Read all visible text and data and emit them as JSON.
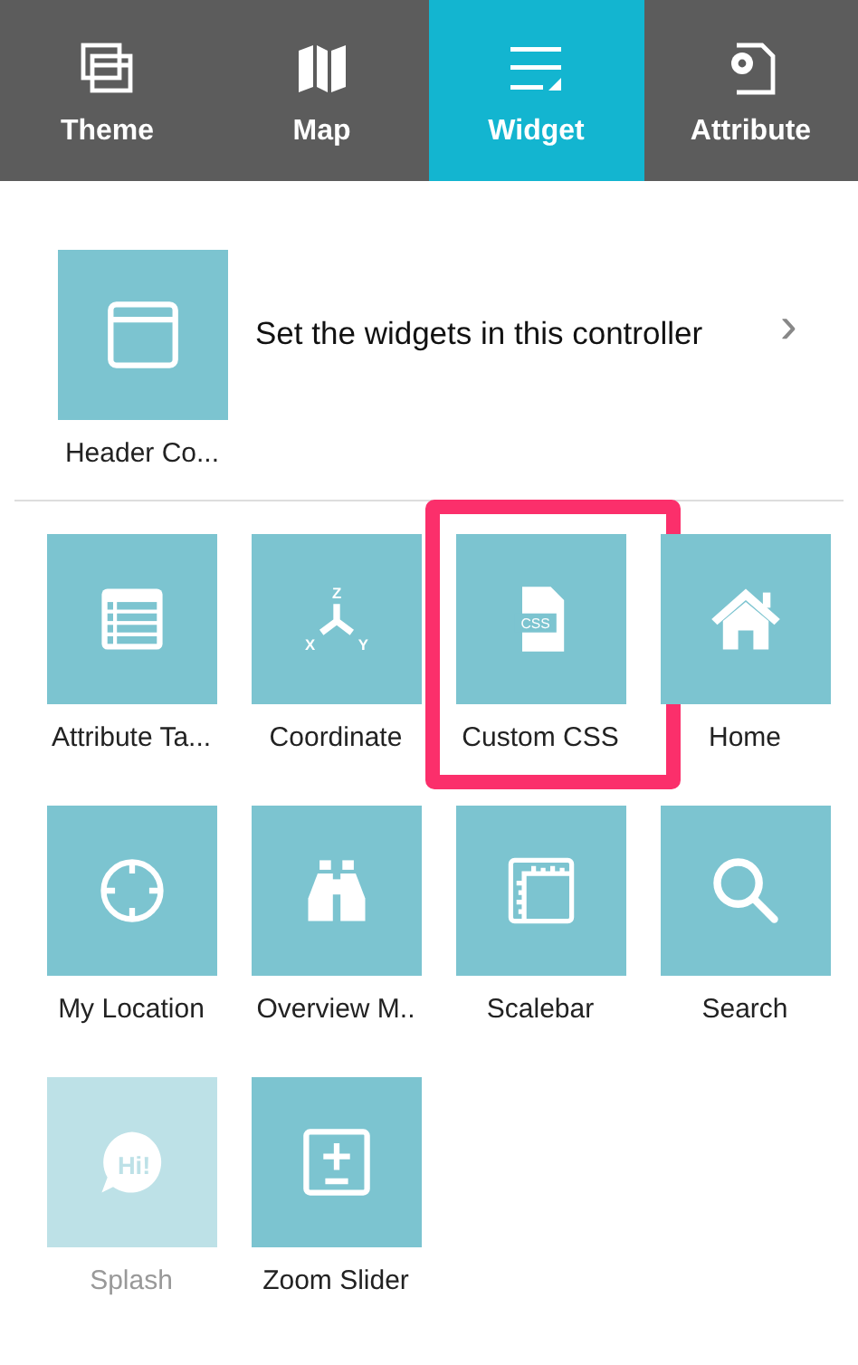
{
  "tabs": [
    {
      "label": "Theme",
      "selected": false
    },
    {
      "label": "Map",
      "selected": false
    },
    {
      "label": "Widget",
      "selected": true
    },
    {
      "label": "Attribute",
      "selected": false
    }
  ],
  "controller": {
    "label": "Header Co...",
    "description": "Set the widgets in this controller",
    "chevron": "›"
  },
  "widgets": [
    {
      "label": "Attribute Ta...",
      "enabled": true,
      "highlighted": false
    },
    {
      "label": "Coordinate",
      "enabled": true,
      "highlighted": false,
      "icon_text": [
        "Z",
        "X",
        "Y"
      ]
    },
    {
      "label": "Custom CSS",
      "enabled": true,
      "highlighted": true,
      "icon_text": [
        "CSS"
      ]
    },
    {
      "label": "Home",
      "enabled": true,
      "highlighted": false
    },
    {
      "label": "My Location",
      "enabled": true,
      "highlighted": false
    },
    {
      "label": "Overview M..",
      "enabled": true,
      "highlighted": false
    },
    {
      "label": "Scalebar",
      "enabled": true,
      "highlighted": false
    },
    {
      "label": "Search",
      "enabled": true,
      "highlighted": false
    },
    {
      "label": "Splash",
      "enabled": false,
      "highlighted": false,
      "icon_text": [
        "Hi!"
      ]
    },
    {
      "label": "Zoom Slider",
      "enabled": true,
      "highlighted": false
    }
  ]
}
